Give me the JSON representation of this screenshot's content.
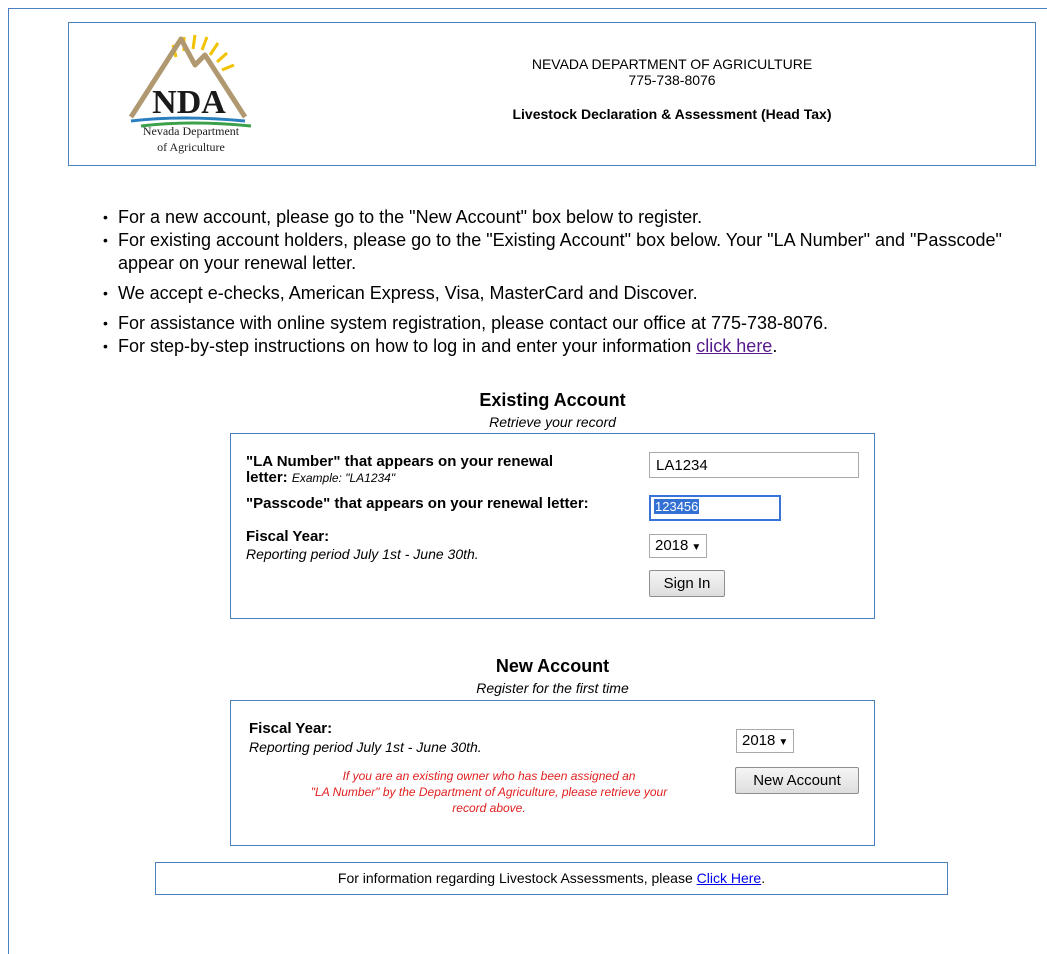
{
  "header": {
    "logo_text": "NDA",
    "logo_caption_line1": "Nevada Department",
    "logo_caption_line2": "of Agriculture",
    "org_name": "NEVADA DEPARTMENT OF AGRICULTURE",
    "phone": "775-738-8076",
    "page_title": "Livestock Declaration & Assessment (Head Tax)"
  },
  "info": {
    "item1": "For a new account, please go to the \"New Account\" box below to register.",
    "item2": "For existing account holders, please go to the \"Existing Account\" box below. Your \"LA Number\" and \"Passcode\" appear on your renewal letter.",
    "item3": "We accept e-checks, American Express, Visa, MasterCard and Discover.",
    "item4": "For assistance with online system registration, please contact our office at 775-738-8076.",
    "item5_prefix": "For step-by-step instructions on how to log in and enter your information ",
    "item5_link": "click here",
    "item5_suffix": "."
  },
  "existing": {
    "title": "Existing Account",
    "subtitle": "Retrieve your record",
    "la_label_line1": "\"LA Number\" that appears on your renewal",
    "la_label_line2": "letter:",
    "la_example": "Example: \"LA1234\"",
    "la_value": "LA1234",
    "passcode_label": "\"Passcode\" that appears on your renewal letter:",
    "passcode_value": "123456",
    "fiscal_label": "Fiscal Year:",
    "fiscal_sub": "Reporting period July 1st - June 30th.",
    "fiscal_value": "2018",
    "signin_label": "Sign In"
  },
  "new_account": {
    "title": "New Account",
    "subtitle": "Register for the first time",
    "fiscal_label": "Fiscal Year:",
    "fiscal_sub": "Reporting period July 1st - June 30th.",
    "fiscal_value": "2018",
    "note_line1": "If you are an existing owner who has been assigned an",
    "note_line2": "\"LA Number\" by the Department of Agriculture, please retrieve your",
    "note_line3": "record above.",
    "button_label": "New Account"
  },
  "footer": {
    "text": "For information regarding Livestock Assessments, please ",
    "link": "Click Here",
    "suffix": "."
  },
  "colors": {
    "border_blue": "#4a7fc0",
    "note_red": "#e02020",
    "link_visited": "#551a8b",
    "link_blue": "#0000ee",
    "selection_blue": "#3370d3"
  }
}
